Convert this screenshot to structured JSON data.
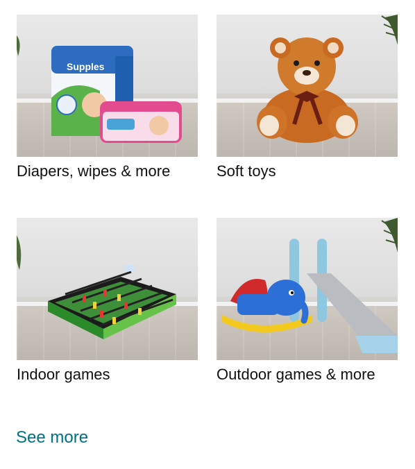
{
  "cards": [
    {
      "label": "Diapers, wipes & more"
    },
    {
      "label": "Soft toys"
    },
    {
      "label": "Indoor games"
    },
    {
      "label": "Outdoor games & more"
    }
  ],
  "see_more": "See more",
  "colors": {
    "link": "#007185",
    "text": "#0f1111"
  }
}
